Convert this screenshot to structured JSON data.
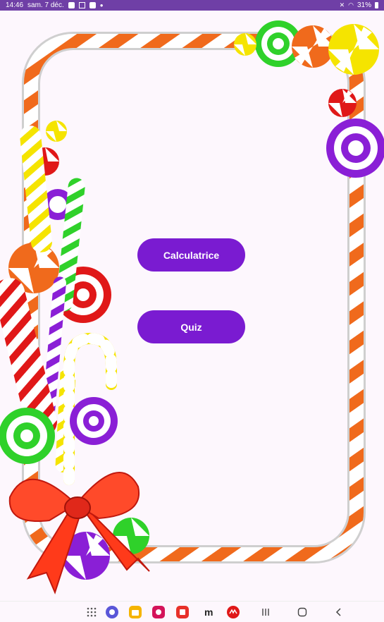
{
  "status_bar": {
    "time": "14:46",
    "date": "sam. 7 déc.",
    "battery": "31%",
    "icons": [
      "photo-icon",
      "gmail-icon",
      "photo-icon",
      "dot-icon",
      "mute-icon",
      "wifi-icon",
      "battery-icon"
    ]
  },
  "buttons": {
    "calculatrice": "Calculatrice",
    "quiz": "Quiz"
  },
  "nav_bar": {
    "apps": [
      "app-drawer-icon",
      "browser-icon",
      "files-icon",
      "gallery-icon",
      "notes-icon",
      "messenger-icon",
      "app-red-icon"
    ],
    "system": [
      "recents-icon",
      "home-icon",
      "back-icon"
    ]
  },
  "colors": {
    "status_bar": "#6f3fa6",
    "button": "#7a1bd1",
    "background": "#fdf7fd",
    "cane_stripe": "#f06a1c"
  }
}
